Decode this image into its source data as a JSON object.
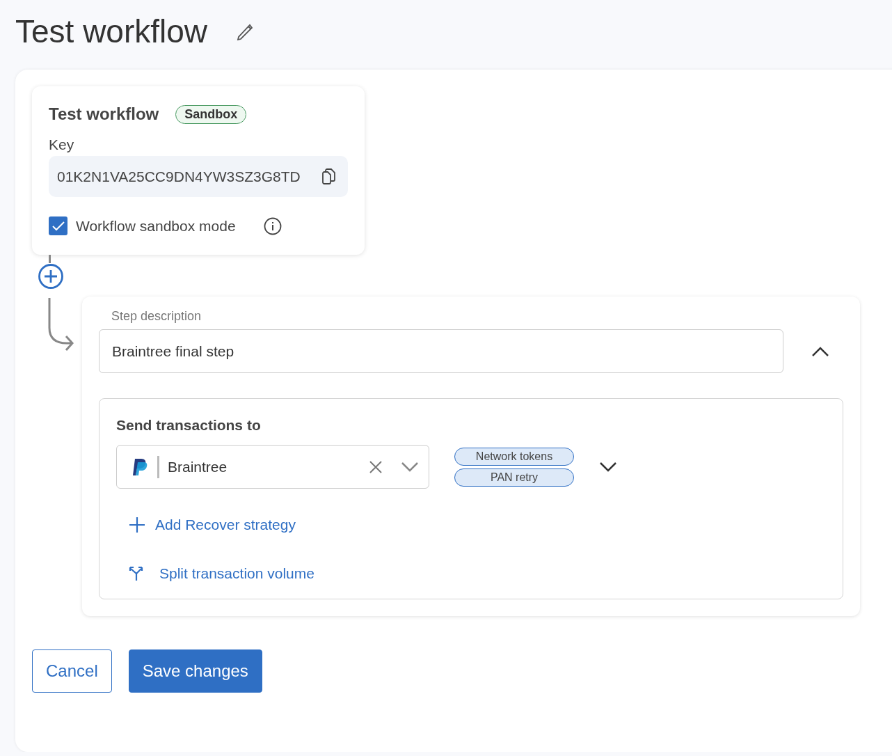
{
  "page_title": "Test workflow",
  "workflow_card": {
    "title": "Test workflow",
    "badge": "Sandbox",
    "key_label": "Key",
    "key_value": "01K2N1VA25CC9DN4YW3SZ3G8TD",
    "sandbox_mode": {
      "label": "Workflow sandbox mode",
      "checked": true
    }
  },
  "step": {
    "description_label": "Step description",
    "description_value": "Braintree final step",
    "expanded": true,
    "destination": {
      "label": "Send transactions to",
      "processor": "Braintree",
      "tags": [
        "Network tokens",
        "PAN retry"
      ]
    },
    "actions": [
      {
        "kind": "add",
        "label": "Add Recover strategy"
      },
      {
        "kind": "split",
        "label": "Split transaction volume"
      }
    ]
  },
  "buttons": [
    {
      "kind": "secondary",
      "label": "Cancel"
    },
    {
      "kind": "primary",
      "label": "Save changes"
    }
  ]
}
